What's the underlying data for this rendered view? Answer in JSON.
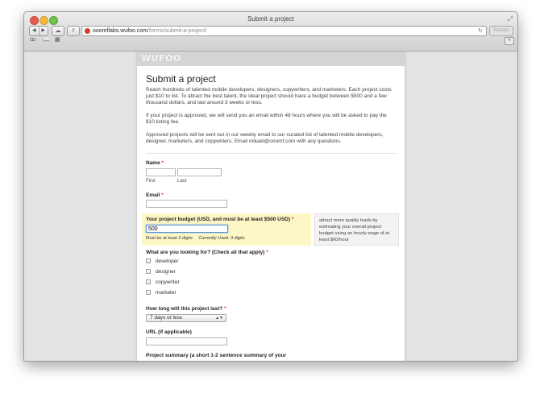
{
  "window": {
    "title": "Submit a project"
  },
  "browser": {
    "url_host": "ooomflabs.wufoo.com",
    "url_path": "/forms/submit-a-project/",
    "reader_label": "Reader"
  },
  "brand": {
    "logo": "WUFOO"
  },
  "form": {
    "title": "Submit a project",
    "intro": [
      "Reach hundreds of talented mobile developers, designers, copywriters, and marketers. Each project costs just $10 to list. To attract the best talent, the ideal project should have a budget between $500 and a few thousand dollars, and last around 3 weeks or less.",
      "If your project is approved, we will send you an email within 48 hours where you will be asked to pay the $10 listing fee.",
      "Approved projects will be sent out in our weekly email to our curated list of talented mobile developers, designer, marketers, and copywriters. Email mikael@ooomf.com with any questions."
    ],
    "name": {
      "label": "Name",
      "required": "*",
      "first": "First",
      "last": "Last"
    },
    "email": {
      "label": "Email",
      "required": "*"
    },
    "budget": {
      "label": "Your project budget (USD, and must be at least $500 USD)",
      "required": "*",
      "value": "500",
      "hint": "Must be at least 3 digits.",
      "used": "Currently Used: 3 digits.",
      "instructions": "attract more quality leads by estimating your overall project budget using an hourly wage of at least $60/hour"
    },
    "looking_for": {
      "label": "What are you looking for? (Check all that apply)",
      "required": "*",
      "options": [
        "developer",
        "designer",
        "copywriter",
        "marketer"
      ]
    },
    "duration": {
      "label": "How long will this project last?",
      "required": "*",
      "selected": "7 days or less"
    },
    "url": {
      "label": "URL (if applicable)"
    },
    "summary": {
      "label": "Project summary (a short 1-2 sentence summary of your"
    }
  }
}
